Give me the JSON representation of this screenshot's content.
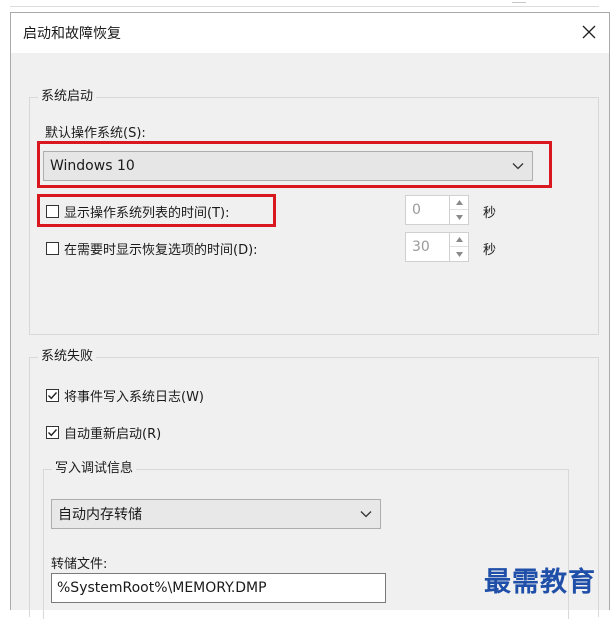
{
  "window": {
    "title": "启动和故障恢复"
  },
  "system_startup": {
    "group_title": "系统启动",
    "default_os_label": "默认操作系统(S):",
    "default_os_value": "Windows 10",
    "show_os_list": {
      "label": "显示操作系统列表的时间(T):",
      "checked": false,
      "value": "0",
      "unit": "秒"
    },
    "show_recovery": {
      "label": "在需要时显示恢复选项的时间(D):",
      "checked": false,
      "value": "30",
      "unit": "秒"
    }
  },
  "system_failure": {
    "group_title": "系统失败",
    "write_event": {
      "label": "将事件写入系统日志(W)",
      "checked": true
    },
    "auto_restart": {
      "label": "自动重新启动(R)",
      "checked": true
    },
    "debug_info": {
      "group_title": "写入调试信息",
      "type_value": "自动内存转储",
      "dump_file_label": "转储文件:",
      "dump_file_value": "%SystemRoot%\\MEMORY.DMP"
    }
  },
  "watermark": "最需教育",
  "colors": {
    "highlight_box": "#d9171e",
    "watermark": "#1f4fa8",
    "dialog_bg": "#f0f0f0"
  },
  "icons": {
    "close": "close-icon",
    "dropdown": "chevron-down-icon",
    "check": "checkmark-icon",
    "spin_up": "spin-up-icon",
    "spin_down": "spin-down-icon"
  }
}
